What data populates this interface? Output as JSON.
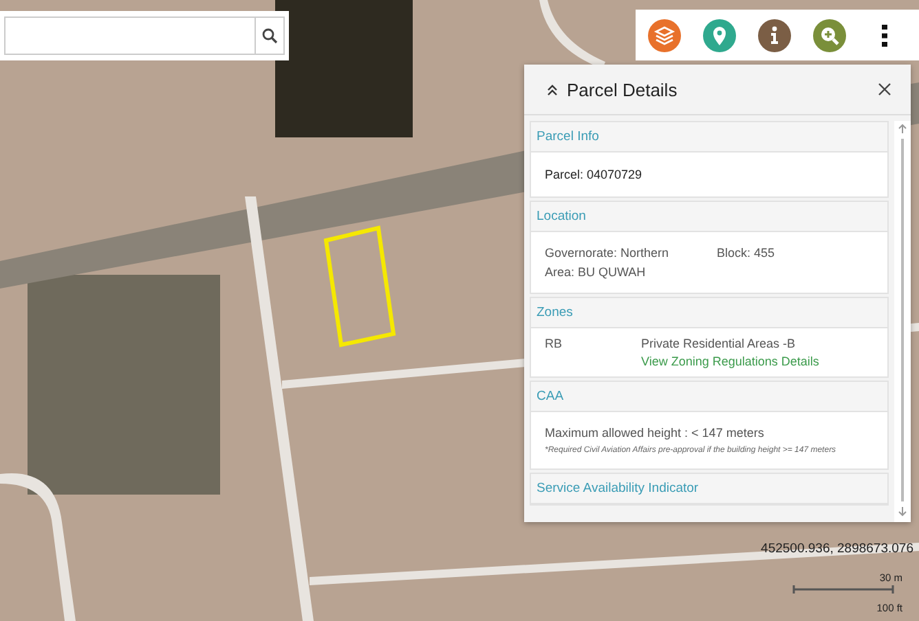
{
  "panel": {
    "title": "Parcel Details",
    "sections": [
      {
        "kind": "single",
        "title": "Parcel Info",
        "lines": [
          "Parcel: 04070729"
        ]
      },
      {
        "kind": "fields",
        "title": "Location",
        "lines": [
          "Governorate: Northern",
          "Block: 455",
          "Area: BU QUWAH"
        ]
      },
      {
        "kind": "zone",
        "title": "Zones",
        "code": "RB",
        "description": "Private Residential Areas -B",
        "link": "View Zoning Regulations Details"
      },
      {
        "kind": "note",
        "title": "CAA",
        "lines": [
          "Maximum allowed height : < 147 meters"
        ],
        "note": "*Required Civil Aviation Affairs pre-approval if the building height >= 147 meters"
      },
      {
        "kind": "header",
        "title": "Service Availability Indicator"
      }
    ]
  },
  "coordinates": "452500.936, 2898673.076",
  "scale": {
    "metric": "30 m",
    "imperial": "100 ft"
  }
}
